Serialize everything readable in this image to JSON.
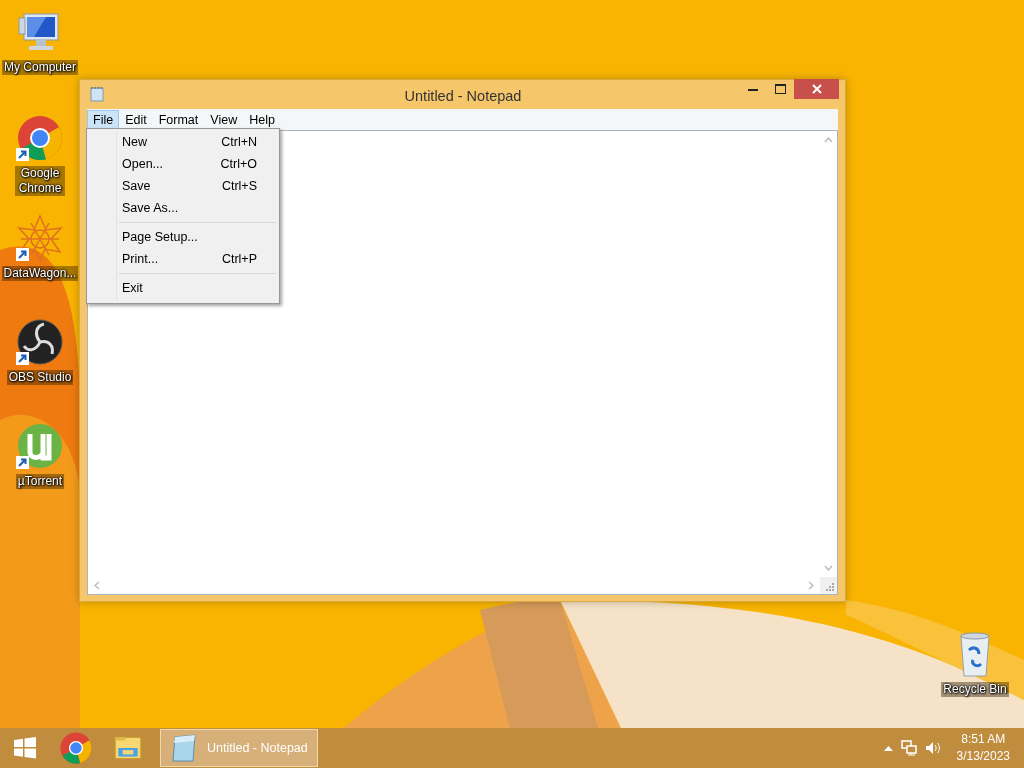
{
  "desktop_icons": [
    {
      "kind": "computer",
      "label": "My Computer",
      "shortcut": false
    },
    {
      "kind": "chrome",
      "label": "Google Chrome",
      "shortcut": true
    },
    {
      "kind": "datawagon",
      "label": "DataWagon...",
      "shortcut": true
    },
    {
      "kind": "obs",
      "label": "OBS Studio",
      "shortcut": true
    },
    {
      "kind": "utorrent",
      "label": "µTorrent",
      "shortcut": true
    },
    {
      "kind": "recycle",
      "label": "Recycle Bin",
      "shortcut": false
    }
  ],
  "window": {
    "title": "Untitled - Notepad",
    "menu": [
      {
        "label": "File",
        "selected": true
      },
      {
        "label": "Edit",
        "selected": false
      },
      {
        "label": "Format",
        "selected": false
      },
      {
        "label": "View",
        "selected": false
      },
      {
        "label": "Help",
        "selected": false
      }
    ],
    "file_menu": [
      {
        "kind": "item",
        "label": "New",
        "shortcut": "Ctrl+N"
      },
      {
        "kind": "item",
        "label": "Open...",
        "shortcut": "Ctrl+O"
      },
      {
        "kind": "item",
        "label": "Save",
        "shortcut": "Ctrl+S"
      },
      {
        "kind": "item",
        "label": "Save As..."
      },
      {
        "kind": "separator"
      },
      {
        "kind": "item",
        "label": "Page Setup..."
      },
      {
        "kind": "item",
        "label": "Print...",
        "shortcut": "Ctrl+P"
      },
      {
        "kind": "separator"
      },
      {
        "kind": "item",
        "label": "Exit"
      }
    ]
  },
  "taskbar": {
    "pinned": [
      {
        "kind": "start"
      },
      {
        "kind": "chrome"
      },
      {
        "kind": "explorer"
      }
    ],
    "tasks": [
      {
        "label": "Untitled - Notepad",
        "selected": true
      }
    ],
    "tray": {
      "time": "8:51 AM",
      "date": "3/13/2023"
    }
  }
}
